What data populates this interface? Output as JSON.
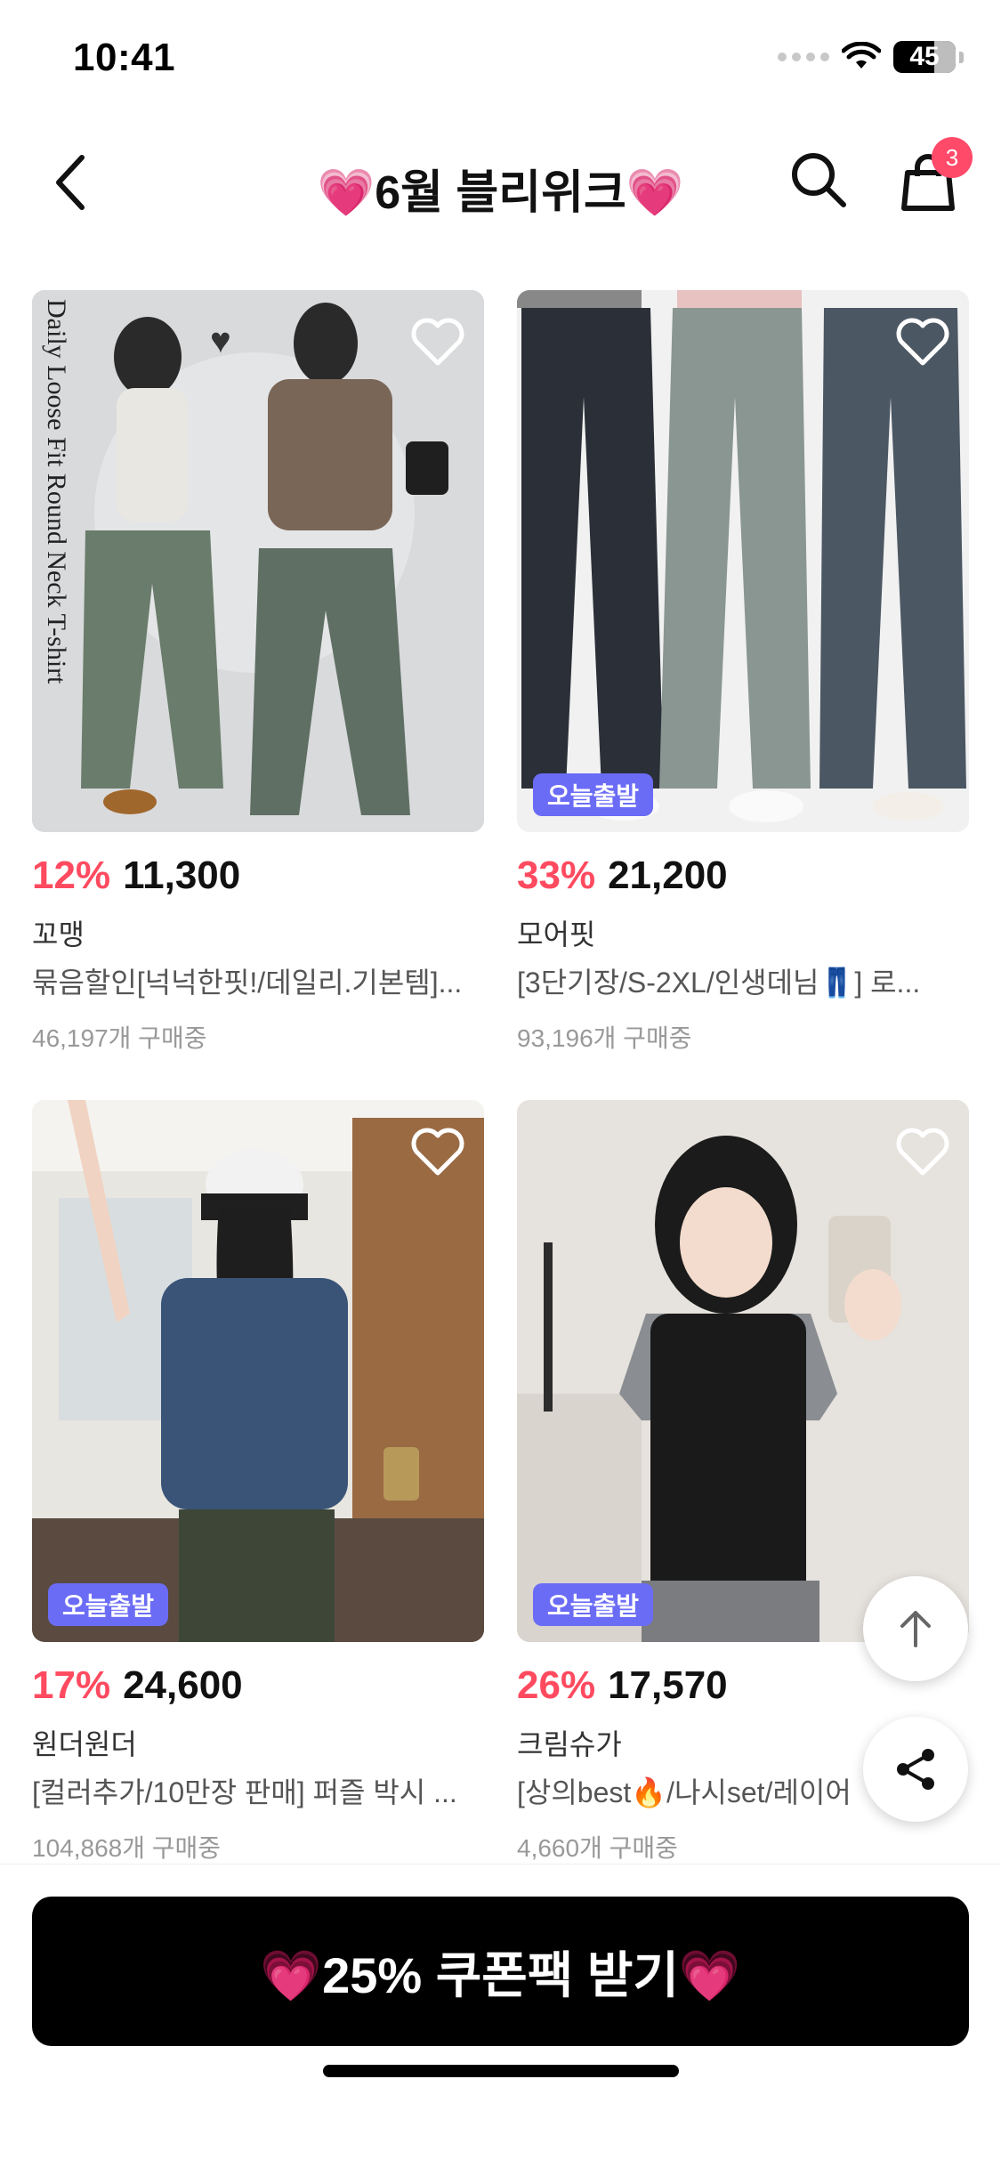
{
  "status_bar": {
    "time": "10:41",
    "battery": "45"
  },
  "header": {
    "title": "💗6월 블리위크💗",
    "cart_count": "3"
  },
  "products": [
    {
      "discount": "12%",
      "price": "11,300",
      "brand": "꼬맹",
      "desc": "묶음할인[넉넉한핏!/데일리.기본템]...",
      "sold": "46,197개 구매중",
      "badge": "",
      "photo_text": "Daily Loose Fit Round Neck T-shirt"
    },
    {
      "discount": "33%",
      "price": "21,200",
      "brand": "모어핏",
      "desc": "[3단기장/S-2XL/인생데님👖] 로...",
      "sold": "93,196개 구매중",
      "badge": "오늘출발"
    },
    {
      "discount": "17%",
      "price": "24,600",
      "brand": "원더원더",
      "desc": "[컬러추가/10만장 판매] 퍼즐 박시 ...",
      "sold": "104,868개 구매중",
      "badge": "오늘출발"
    },
    {
      "discount": "26%",
      "price": "17,570",
      "brand": "크림슈가",
      "desc": "[상의best🔥/나시set/레이어",
      "sold": "4,660개 구매중",
      "badge": "오늘출발"
    }
  ],
  "cta": {
    "label": "💗25% 쿠폰팩 받기💗"
  },
  "colors": {
    "discount": "#ff4a5f",
    "badge": "#6b6cf6",
    "cart_badge": "#ff4a6a",
    "cta_bg": "#000000"
  },
  "icons": [
    "back-arrow-icon",
    "search-icon",
    "cart-icon",
    "heart-icon",
    "arrow-up-icon",
    "share-icon",
    "wifi-icon"
  ]
}
